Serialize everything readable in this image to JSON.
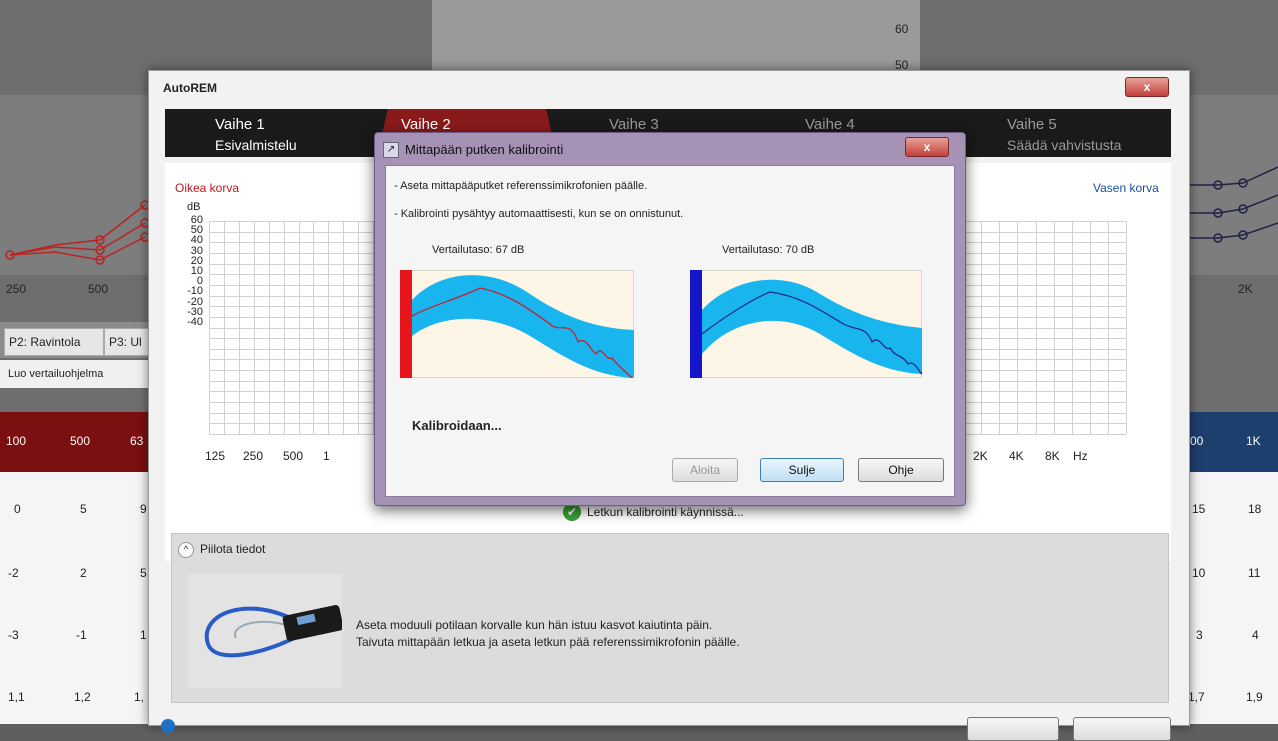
{
  "background": {
    "y_labels": [
      "60",
      "50"
    ],
    "freq_labels": [
      "250",
      "500",
      "2K"
    ],
    "tabs": [
      "P2: Ravintola",
      "P3: Ul"
    ],
    "create_label": "Luo vertailuohjelma",
    "head_left": [
      "100",
      "500",
      "63"
    ],
    "head_right": [
      "00",
      "1K"
    ],
    "rows_left": [
      [
        "0",
        "5",
        "9"
      ],
      [
        "-2",
        "2",
        "5"
      ],
      [
        "-3",
        "-1",
        "1"
      ],
      [
        "1,1",
        "1,2",
        "1,"
      ]
    ],
    "rows_right": [
      [
        "15",
        "18"
      ],
      [
        "10",
        "11"
      ],
      [
        "3",
        "4"
      ],
      [
        "1,7",
        "1,9"
      ]
    ]
  },
  "autorem": {
    "title": "AutoREM",
    "close_glyph": "x",
    "steps": [
      {
        "label": "Vaihe 1",
        "sub": "Esivalmistelu"
      },
      {
        "label": "Vaihe 2",
        "sub": ""
      },
      {
        "label": "Vaihe 3",
        "sub": ""
      },
      {
        "label": "Vaihe 4",
        "sub": ""
      },
      {
        "label": "Vaihe 5",
        "sub": "Säädä vahvistusta"
      }
    ],
    "right_ear": "Oikea korva",
    "left_ear": "Vasen korva",
    "y_unit": "dB",
    "y_ticks": [
      "60",
      "50",
      "40",
      "30",
      "20",
      "10",
      "0",
      "-10",
      "-20",
      "-30",
      "-40"
    ],
    "x_ticks_left": [
      "125",
      "250",
      "500",
      "1"
    ],
    "x_ticks_right": [
      "2K",
      "4K",
      "8K"
    ],
    "x_unit": "Hz",
    "status": "Letkun kalibrointi käynnissä...",
    "hide_details": "Piilota tiedot",
    "instruction_1": "Aseta moduuli potilaan korvalle kun hän istuu kasvot kaiutinta päin.",
    "instruction_2": "Taivuta mittapään letkua ja aseta letkun pää referenssimikrofonin päälle."
  },
  "calibration": {
    "title": "Mittapään putken kalibrointi",
    "close_glyph": "x",
    "line1": "- Aseta mittapääputket referenssimikrofonien päälle.",
    "line2": "- Kalibrointi pysähtyy automaattisesti, kun se on onnistunut.",
    "ref_left": "Vertailutaso: 67 dB",
    "ref_right": "Vertailutaso: 70 dB",
    "status": "Kalibroidaan...",
    "btn_start": "Aloita",
    "btn_close": "Sulje",
    "btn_help": "Ohje",
    "colors": {
      "band": "#19b5ee",
      "left_accent": "#e8141c",
      "right_accent": "#1414c8",
      "plot_bg": "#fdf5e6"
    }
  }
}
